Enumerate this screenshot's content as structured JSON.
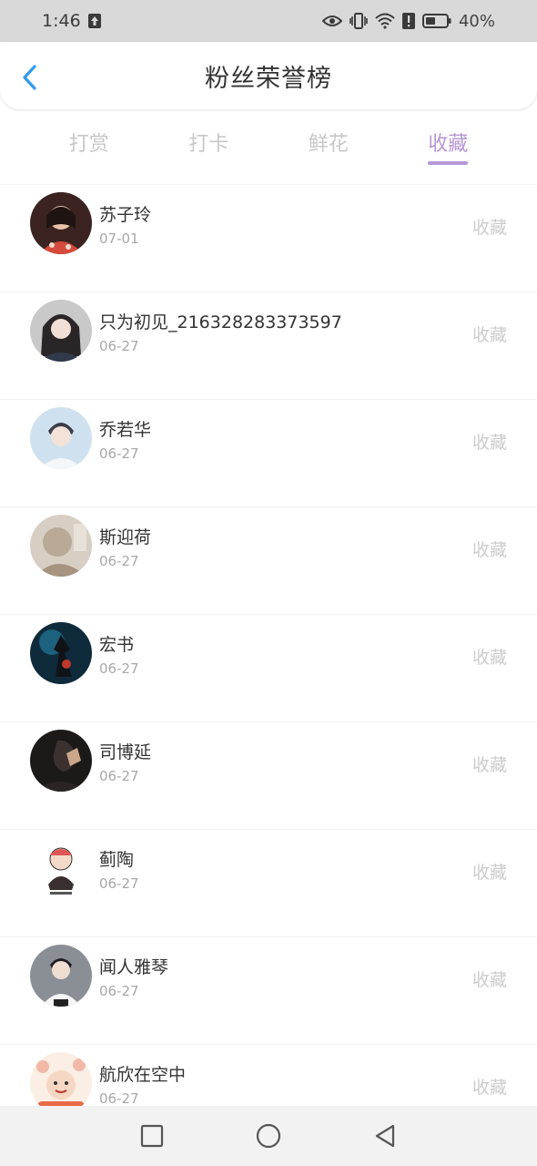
{
  "status_bar": {
    "time": "1:46",
    "battery": "40%",
    "icons": [
      "upload-icon",
      "eye-icon",
      "vibrate-icon",
      "wifi-icon",
      "alert-icon",
      "battery-icon"
    ]
  },
  "header": {
    "title": "粉丝荣誉榜",
    "back_icon": "chevron-left-icon"
  },
  "tabs": [
    {
      "label": "打赏",
      "active": false
    },
    {
      "label": "打卡",
      "active": false
    },
    {
      "label": "鲜花",
      "active": false
    },
    {
      "label": "收藏",
      "active": true
    }
  ],
  "fans": [
    {
      "name": "苏子玲",
      "date": "07-01",
      "action": "收藏"
    },
    {
      "name": "只为初见_216328283373597",
      "date": "06-27",
      "action": "收藏"
    },
    {
      "name": "乔若华",
      "date": "06-27",
      "action": "收藏"
    },
    {
      "name": "斯迎荷",
      "date": "06-27",
      "action": "收藏"
    },
    {
      "name": "宏书",
      "date": "06-27",
      "action": "收藏"
    },
    {
      "name": "司博延",
      "date": "06-27",
      "action": "收藏"
    },
    {
      "name": "蓟陶",
      "date": "06-27",
      "action": "收藏"
    },
    {
      "name": "闻人雅琴",
      "date": "06-27",
      "action": "收藏"
    },
    {
      "name": "航欣在空中",
      "date": "06-27",
      "action": "收藏"
    }
  ],
  "nav": [
    "recent-apps-icon",
    "home-icon",
    "back-icon"
  ],
  "colors": {
    "accent": "#b697d4",
    "back_arrow": "#2f9bef",
    "muted": "#cccccc"
  }
}
